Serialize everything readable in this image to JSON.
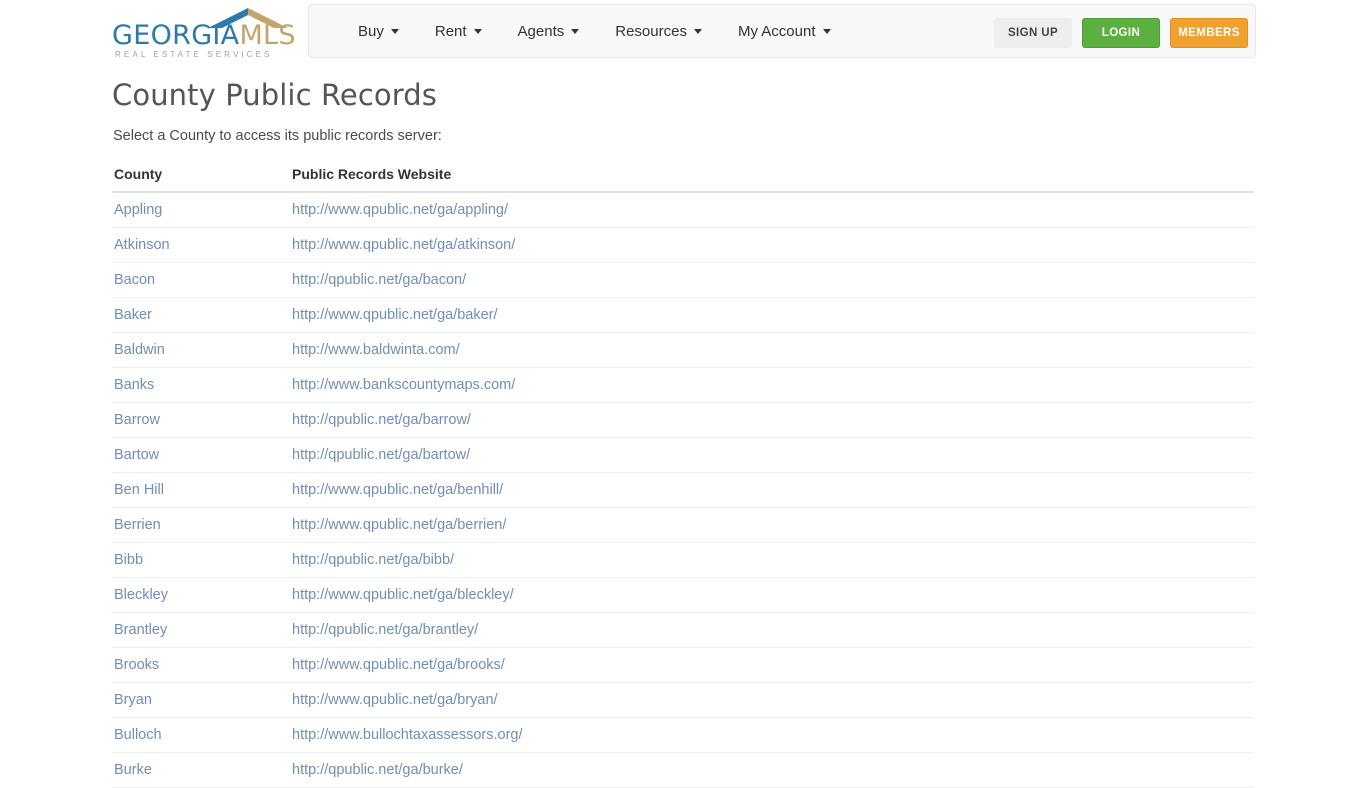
{
  "header": {
    "logo": {
      "brand_primary": "GEORGIA",
      "brand_secondary": "MLS",
      "tagline": "REAL ESTATE SERVICES",
      "color_primary": "#2b7aa8",
      "color_secondary": "#c4a46a"
    },
    "nav": [
      {
        "label": "Buy",
        "has_dropdown": true
      },
      {
        "label": "Rent",
        "has_dropdown": true
      },
      {
        "label": "Agents",
        "has_dropdown": true
      },
      {
        "label": "Resources",
        "has_dropdown": true
      },
      {
        "label": "My Account",
        "has_dropdown": true
      }
    ],
    "buttons": {
      "signup": "SIGN UP",
      "login": "LOGIN",
      "members": "MEMBERS",
      "signup_color": "#eeeeee",
      "login_color": "#5cb040",
      "members_color": "#f0a12e"
    }
  },
  "main": {
    "title": "County Public Records",
    "subtitle": "Select a County to access its public records server:",
    "table": {
      "columns": [
        "County",
        "Public Records Website"
      ],
      "rows": [
        {
          "county": "Appling",
          "url": "http://www.qpublic.net/ga/appling/"
        },
        {
          "county": "Atkinson",
          "url": "http://www.qpublic.net/ga/atkinson/"
        },
        {
          "county": "Bacon",
          "url": "http://qpublic.net/ga/bacon/"
        },
        {
          "county": "Baker",
          "url": "http://www.qpublic.net/ga/baker/"
        },
        {
          "county": "Baldwin",
          "url": "http://www.baldwinta.com/"
        },
        {
          "county": "Banks",
          "url": "http://www.bankscountymaps.com/"
        },
        {
          "county": "Barrow",
          "url": "http://qpublic.net/ga/barrow/"
        },
        {
          "county": "Bartow",
          "url": "http://qpublic.net/ga/bartow/"
        },
        {
          "county": "Ben Hill",
          "url": "http://www.qpublic.net/ga/benhill/"
        },
        {
          "county": "Berrien",
          "url": "http://www.qpublic.net/ga/berrien/"
        },
        {
          "county": "Bibb",
          "url": "http://qpublic.net/ga/bibb/"
        },
        {
          "county": "Bleckley",
          "url": "http://www.qpublic.net/ga/bleckley/"
        },
        {
          "county": "Brantley",
          "url": "http://qpublic.net/ga/brantley/"
        },
        {
          "county": "Brooks",
          "url": "http://www.qpublic.net/ga/brooks/"
        },
        {
          "county": "Bryan",
          "url": "http://www.qpublic.net/ga/bryan/"
        },
        {
          "county": "Bulloch",
          "url": "http://www.bullochtaxassessors.org/"
        },
        {
          "county": "Burke",
          "url": "http://qpublic.net/ga/burke/"
        }
      ]
    }
  }
}
